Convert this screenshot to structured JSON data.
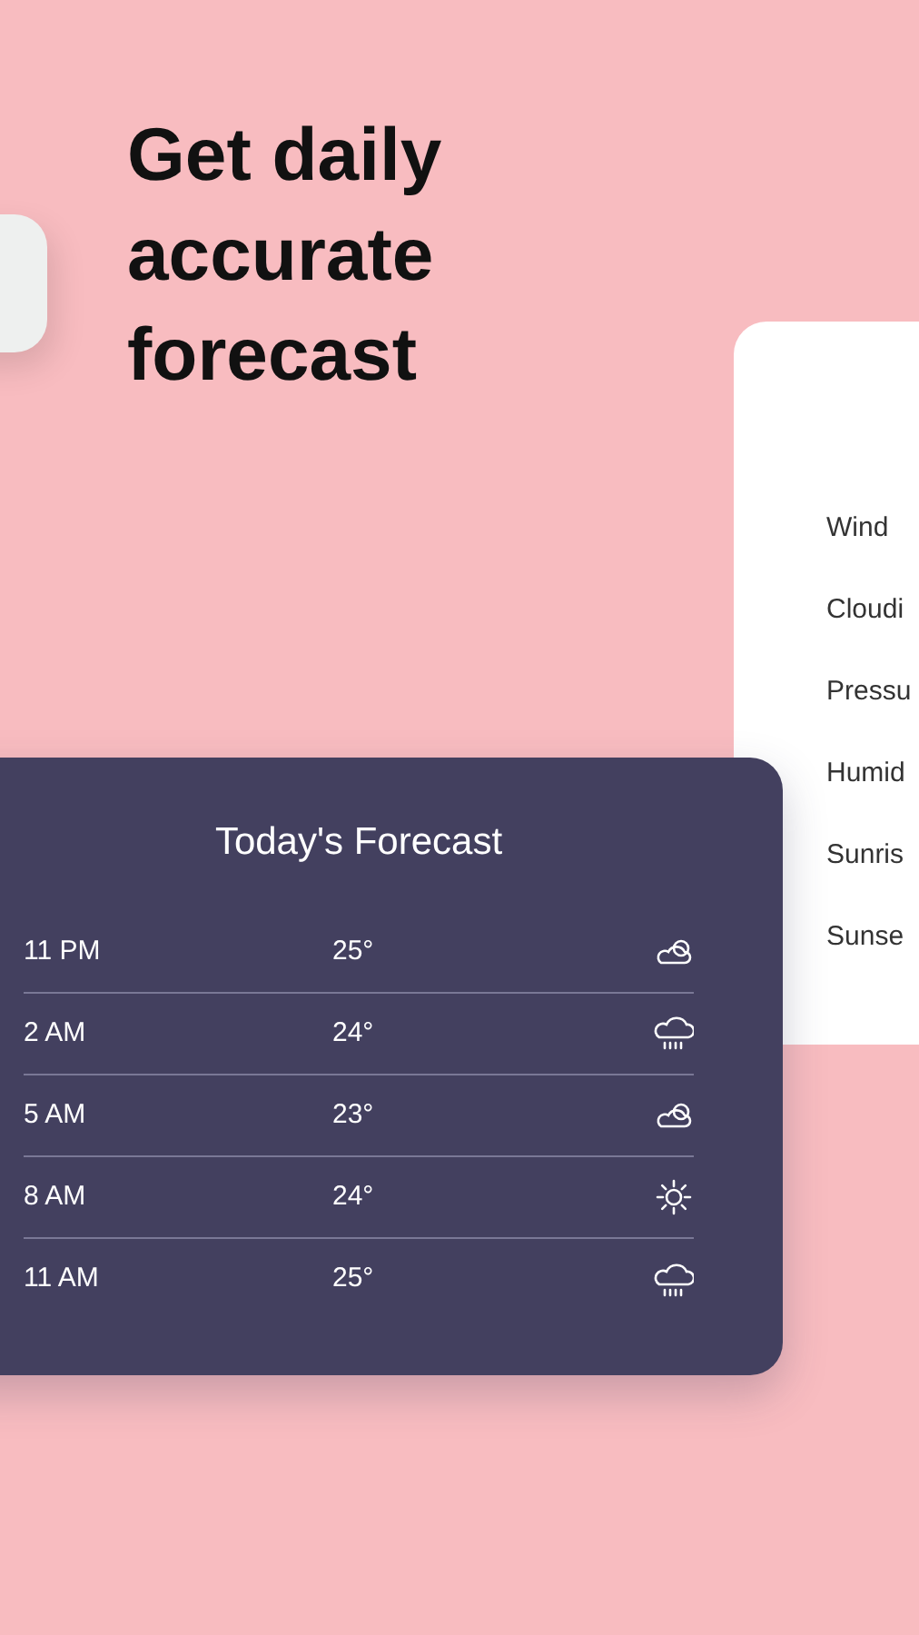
{
  "headline": {
    "lines": [
      "Get daily",
      "accurate",
      "forecast"
    ]
  },
  "details": {
    "labels": [
      "Wind",
      "Cloudi",
      "Pressu",
      "Humid",
      "Sunris",
      "Sunse"
    ]
  },
  "forecast": {
    "title": "Today's Forecast",
    "rows": [
      {
        "time": "11 PM",
        "temp": "25°",
        "kind": "cloudy"
      },
      {
        "time": "2 AM",
        "temp": "24°",
        "kind": "rain"
      },
      {
        "time": "5 AM",
        "temp": "23°",
        "kind": "cloudy"
      },
      {
        "time": "8 AM",
        "temp": "24°",
        "kind": "sun"
      },
      {
        "time": "11 AM",
        "temp": "25°",
        "kind": "rain"
      }
    ]
  }
}
